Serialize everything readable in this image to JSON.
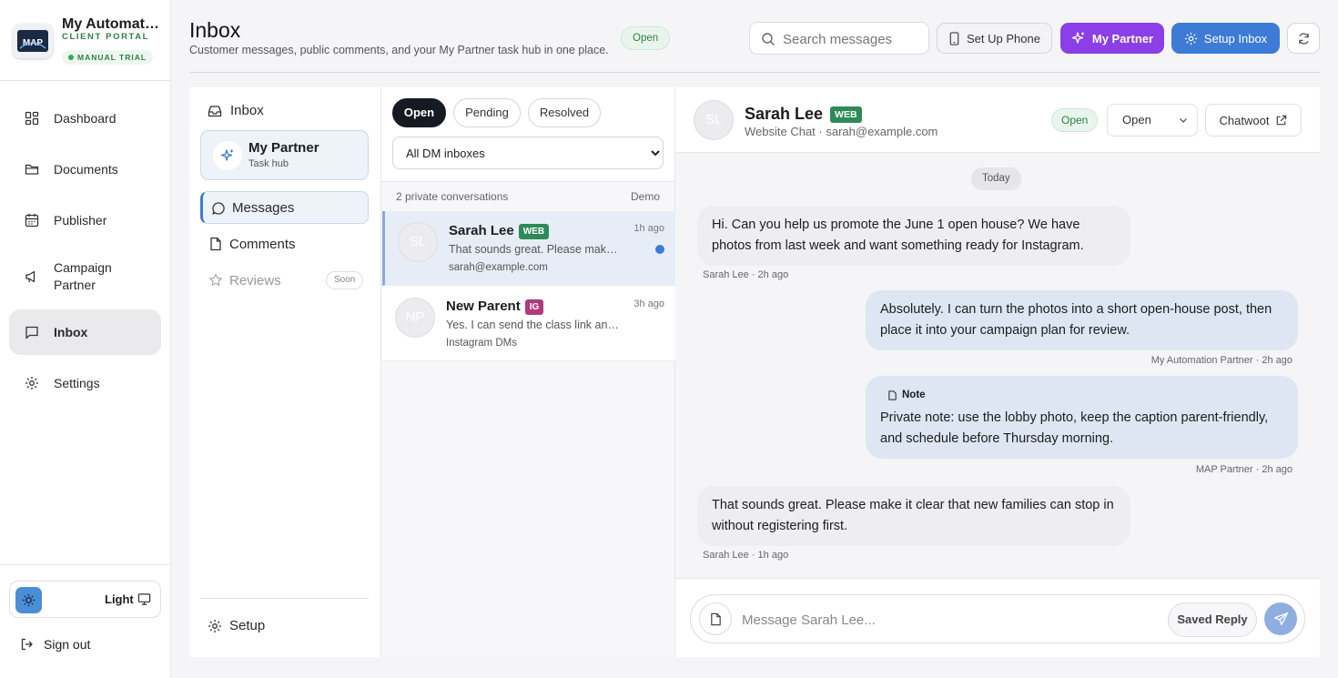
{
  "brand": {
    "name": "My Automation Partner",
    "subtitle": "CLIENT PORTAL",
    "trial": "MANUAL TRIAL",
    "logo_text": "MAP"
  },
  "sidebar": {
    "items": [
      {
        "label": "Dashboard",
        "icon": "dashboard-icon"
      },
      {
        "label": "Documents",
        "icon": "folder-icon"
      },
      {
        "label": "Publisher",
        "icon": "calendar-icon"
      },
      {
        "label": "Campaign Partner",
        "icon": "megaphone-icon"
      },
      {
        "label": "Inbox",
        "icon": "chat-icon",
        "active": true
      },
      {
        "label": "Settings",
        "icon": "gear-icon"
      }
    ],
    "theme_label": "Light",
    "sign_out": "Sign out"
  },
  "header": {
    "title": "Inbox",
    "subtitle": "Customer messages, public comments, and your My Partner task hub in one place.",
    "status_badge": "Open",
    "search_placeholder": "Search messages",
    "phone_button": "Set Up Phone",
    "partner_button": "My Partner",
    "setup_button": "Setup Inbox"
  },
  "panel_nav": {
    "inbox": "Inbox",
    "partner_title": "My Partner",
    "partner_sub": "Task hub",
    "messages": "Messages",
    "comments": "Comments",
    "reviews": "Reviews",
    "soon": "Soon",
    "setup": "Setup"
  },
  "conversations": {
    "tabs": [
      "Open",
      "Pending",
      "Resolved"
    ],
    "filter": "All DM inboxes",
    "count_label": "2 private conversations",
    "demo_label": "Demo",
    "items": [
      {
        "initials": "SL",
        "name": "Sarah Lee",
        "tag": "WEB",
        "time": "1h ago",
        "preview": "That sounds great. Please make it clear that new families can stop in without registering first.",
        "sub": "sarah@example.com",
        "unread": true
      },
      {
        "initials": "NP",
        "name": "New Parent",
        "tag": "IG",
        "time": "3h ago",
        "preview": "Yes. I can send the class link and schedule details.",
        "sub": "Instagram DMs",
        "unread": false
      }
    ]
  },
  "thread": {
    "initials": "SL",
    "name": "Sarah Lee",
    "tag": "WEB",
    "subtitle": "Website Chat · sarah@example.com",
    "status_badge": "Open",
    "status_select": "Open",
    "chatwoot": "Chatwoot",
    "day": "Today",
    "messages": [
      {
        "text": "Hi. Can you help us promote the June 1 open house? We have photos from last week and want something ready for Instagram.",
        "meta": "Sarah Lee · 2h ago"
      },
      {
        "text": "Absolutely. I can turn the photos into a short open-house post, then place it into your campaign plan for review.",
        "meta": "My Automation Partner · 2h ago"
      },
      {
        "label": "Note",
        "text": "Private note: use the lobby photo, keep the caption parent-friendly, and schedule before Thursday morning.",
        "meta": "MAP Partner · 2h ago"
      },
      {
        "text": "That sounds great. Please make it clear that new families can stop in without registering first.",
        "meta": "Sarah Lee · 1h ago"
      }
    ],
    "compose_placeholder": "Message Sarah Lee...",
    "saved_reply": "Saved Reply"
  },
  "colors": {
    "accent_blue": "#3d7bd6",
    "partner_purple": "#8b3fe6",
    "open_green": "#2f7d47"
  }
}
